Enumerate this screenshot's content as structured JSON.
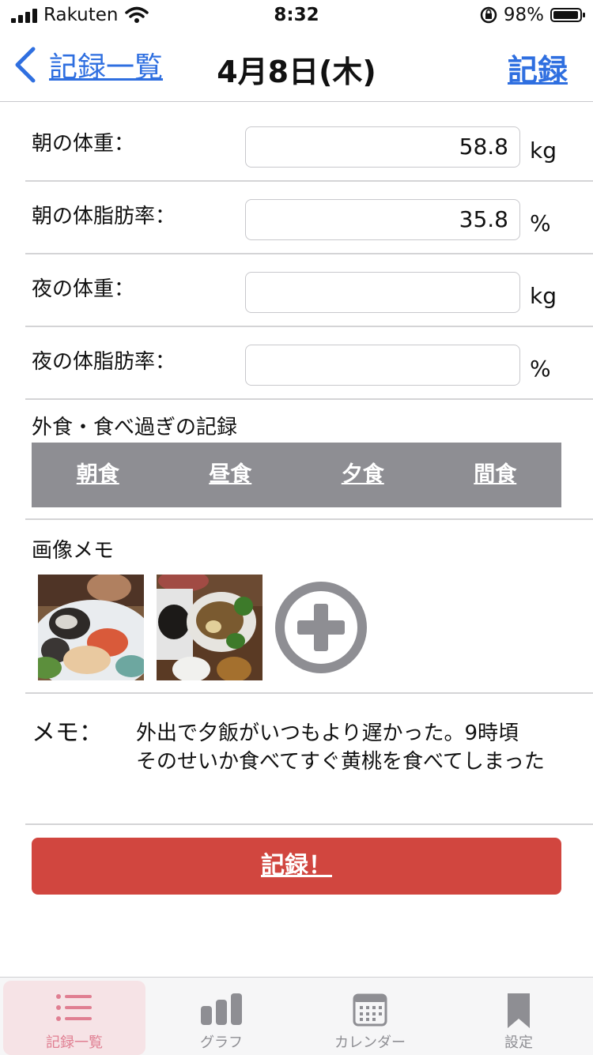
{
  "status_bar": {
    "carrier": "Rakuten",
    "time": "8:32",
    "battery": "98%"
  },
  "nav": {
    "back_label": "記録一覧",
    "title": "4月8日(木)",
    "record_label": "記録"
  },
  "form": {
    "rows": [
      {
        "label": "朝の体重：",
        "value": "58.8",
        "unit": "kg"
      },
      {
        "label": "朝の体脂肪率：",
        "value": "35.8",
        "unit": "%"
      },
      {
        "label": "夜の体重：",
        "value": "",
        "unit": "kg"
      },
      {
        "label": "夜の体脂肪率：",
        "value": "",
        "unit": "%"
      }
    ]
  },
  "eating_out": {
    "label": "外食・食べ過ぎの記録",
    "meals": [
      "朝食",
      "昼食",
      "夕食",
      "間食"
    ]
  },
  "image_memo": {
    "label": "画像メモ"
  },
  "memo": {
    "label": "メモ：",
    "lines": [
      "外出で夕飯がいつもより遅かった。9時頃",
      "そのせいか食べてすぐ黄桃を食べてしまった"
    ]
  },
  "submit_label": "記録！",
  "tabs": [
    {
      "label": "記録一覧",
      "icon": "list-icon",
      "active": true
    },
    {
      "label": "グラフ",
      "icon": "bar-chart-icon",
      "active": false
    },
    {
      "label": "カレンダー",
      "icon": "calendar-icon",
      "active": false
    },
    {
      "label": "設定",
      "icon": "bookmark-icon",
      "active": false
    }
  ],
  "colors": {
    "accent": "#2f6fe0",
    "submit": "#d1463f",
    "meal_bar": "#8e8e93",
    "active_tab": "#e07f92"
  }
}
